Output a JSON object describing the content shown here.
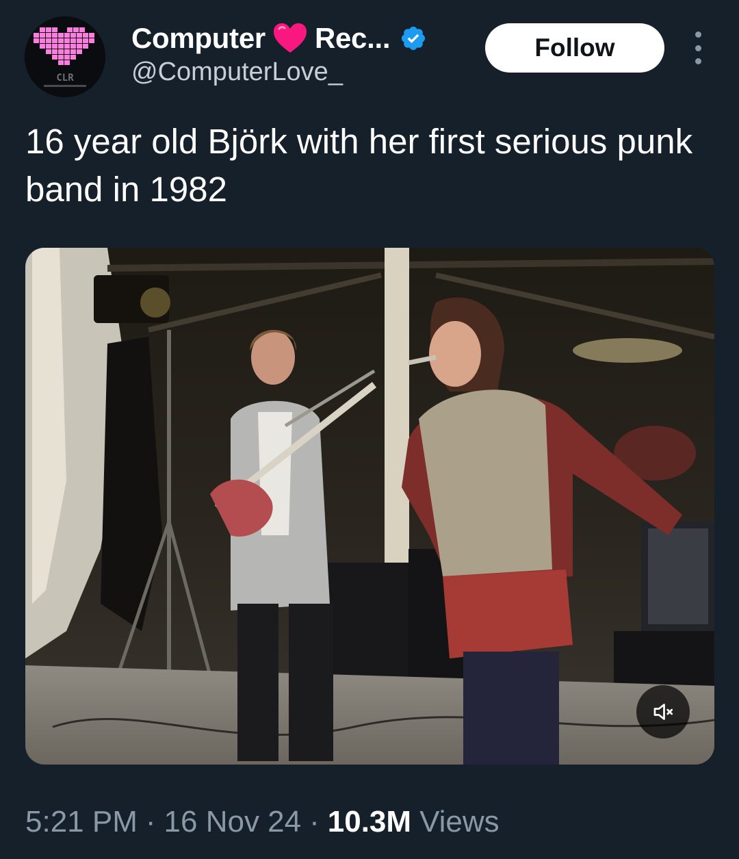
{
  "account": {
    "display_name": "Computer",
    "display_name_suffix": "Rec...",
    "heart_icon": "heart-emoji",
    "verified_icon": "verified-badge",
    "handle": "@ComputerLove_",
    "avatar_text": "CLR"
  },
  "actions": {
    "follow_label": "Follow",
    "more_icon": "more-vertical"
  },
  "tweet": {
    "text": "16 year old Björk with her first serious punk band in 1982"
  },
  "media": {
    "type": "video",
    "mute_icon": "volume-muted"
  },
  "meta": {
    "time": "5:21 PM",
    "separator": "·",
    "date": "16 Nov 24",
    "views_count": "10.3M",
    "views_label": "Views"
  },
  "colors": {
    "background": "#15202b",
    "accent": "#1d9bf0",
    "heart": "#f91880",
    "muted_text": "#8b98a5"
  }
}
